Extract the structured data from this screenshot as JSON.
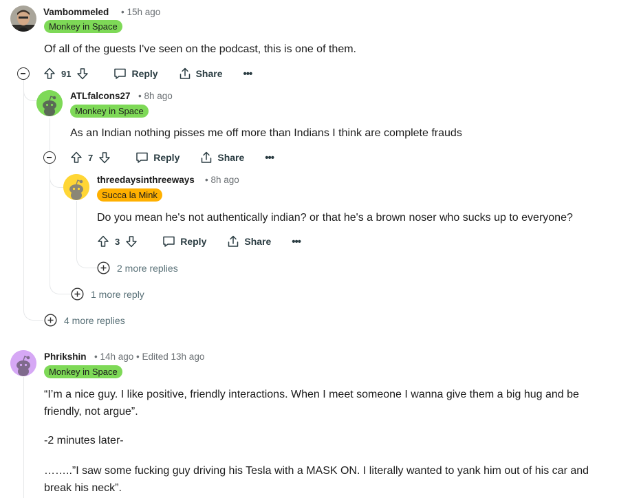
{
  "colors": {
    "flair_green": "#7ed957",
    "flair_orange": "#ffb000",
    "thread_line": "#e5e7e9",
    "meta_gray": "#6a6f73"
  },
  "comments": [
    {
      "username": "Vambommeled",
      "meta": "• 15h ago",
      "flair": "Monkey in Space",
      "body": "Of all of the guests I've seen on the podcast, this is one of them.",
      "score": "91",
      "reply_label": "Reply",
      "share_label": "Share",
      "more_replies": "4 more replies",
      "avatar": "photo-avatar"
    },
    {
      "username": "ATLfalcons27",
      "meta": "• 8h ago",
      "flair": "Monkey in Space",
      "body": "As an Indian nothing pisses me off more than Indians I think are complete frauds",
      "score": "7",
      "reply_label": "Reply",
      "share_label": "Share",
      "more_replies": "1 more reply",
      "avatar": "snoo-green"
    },
    {
      "username": "threedaysinthreeways",
      "meta": "• 8h ago",
      "flair": "Succa la Mink",
      "body": "Do you mean he's not authentically indian? or that he's a brown noser who sucks up to everyone?",
      "score": "3",
      "reply_label": "Reply",
      "share_label": "Share",
      "more_replies": "2 more replies",
      "avatar": "snoo-yellow"
    },
    {
      "username": "Phrikshin",
      "meta": "• 14h ago • Edited 13h ago",
      "flair": "Monkey in Space",
      "paragraphs": [
        "“I’m a nice guy. I like positive, friendly interactions. When I meet someone I wanna give them a big hug and be friendly, not argue”.",
        "-2 minutes later-",
        "……..”I saw some fucking guy driving his Tesla with a MASK ON. I literally wanted to yank him out of his car and break his neck”."
      ],
      "avatar": "snoo-purple"
    }
  ]
}
